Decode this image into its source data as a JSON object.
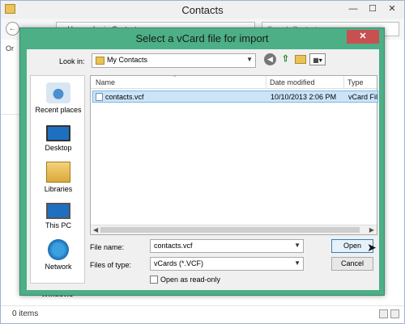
{
  "background_window": {
    "title": "Contacts",
    "address": "« Users › Lori › Contacts",
    "search_placeholder": "Search Contacts",
    "organize": "Or",
    "tree_item": "Windows",
    "status": "0 items",
    "controls": {
      "minimize": "—",
      "maximize": "☐",
      "close": "✕"
    }
  },
  "dialog": {
    "title": "Select a vCard file for import",
    "close": "✕",
    "look_in": {
      "label": "Look in:",
      "value": "My Contacts"
    },
    "places": [
      {
        "label": "Recent places",
        "icon": "recent-places-icon"
      },
      {
        "label": "Desktop",
        "icon": "desktop-icon"
      },
      {
        "label": "Libraries",
        "icon": "libraries-icon"
      },
      {
        "label": "This PC",
        "icon": "this-pc-icon"
      },
      {
        "label": "Network",
        "icon": "network-icon"
      }
    ],
    "columns": {
      "name": "Name",
      "date": "Date modified",
      "type": "Type"
    },
    "files": [
      {
        "name": "contacts.vcf",
        "date": "10/10/2013 2:06 PM",
        "type": "vCard File"
      }
    ],
    "file_name": {
      "label": "File name:",
      "value": "contacts.vcf"
    },
    "file_type": {
      "label": "Files of type:",
      "value": "vCards (*.VCF)"
    },
    "read_only": {
      "label": "Open as read-only",
      "checked": false
    },
    "buttons": {
      "open": "Open",
      "cancel": "Cancel"
    }
  }
}
